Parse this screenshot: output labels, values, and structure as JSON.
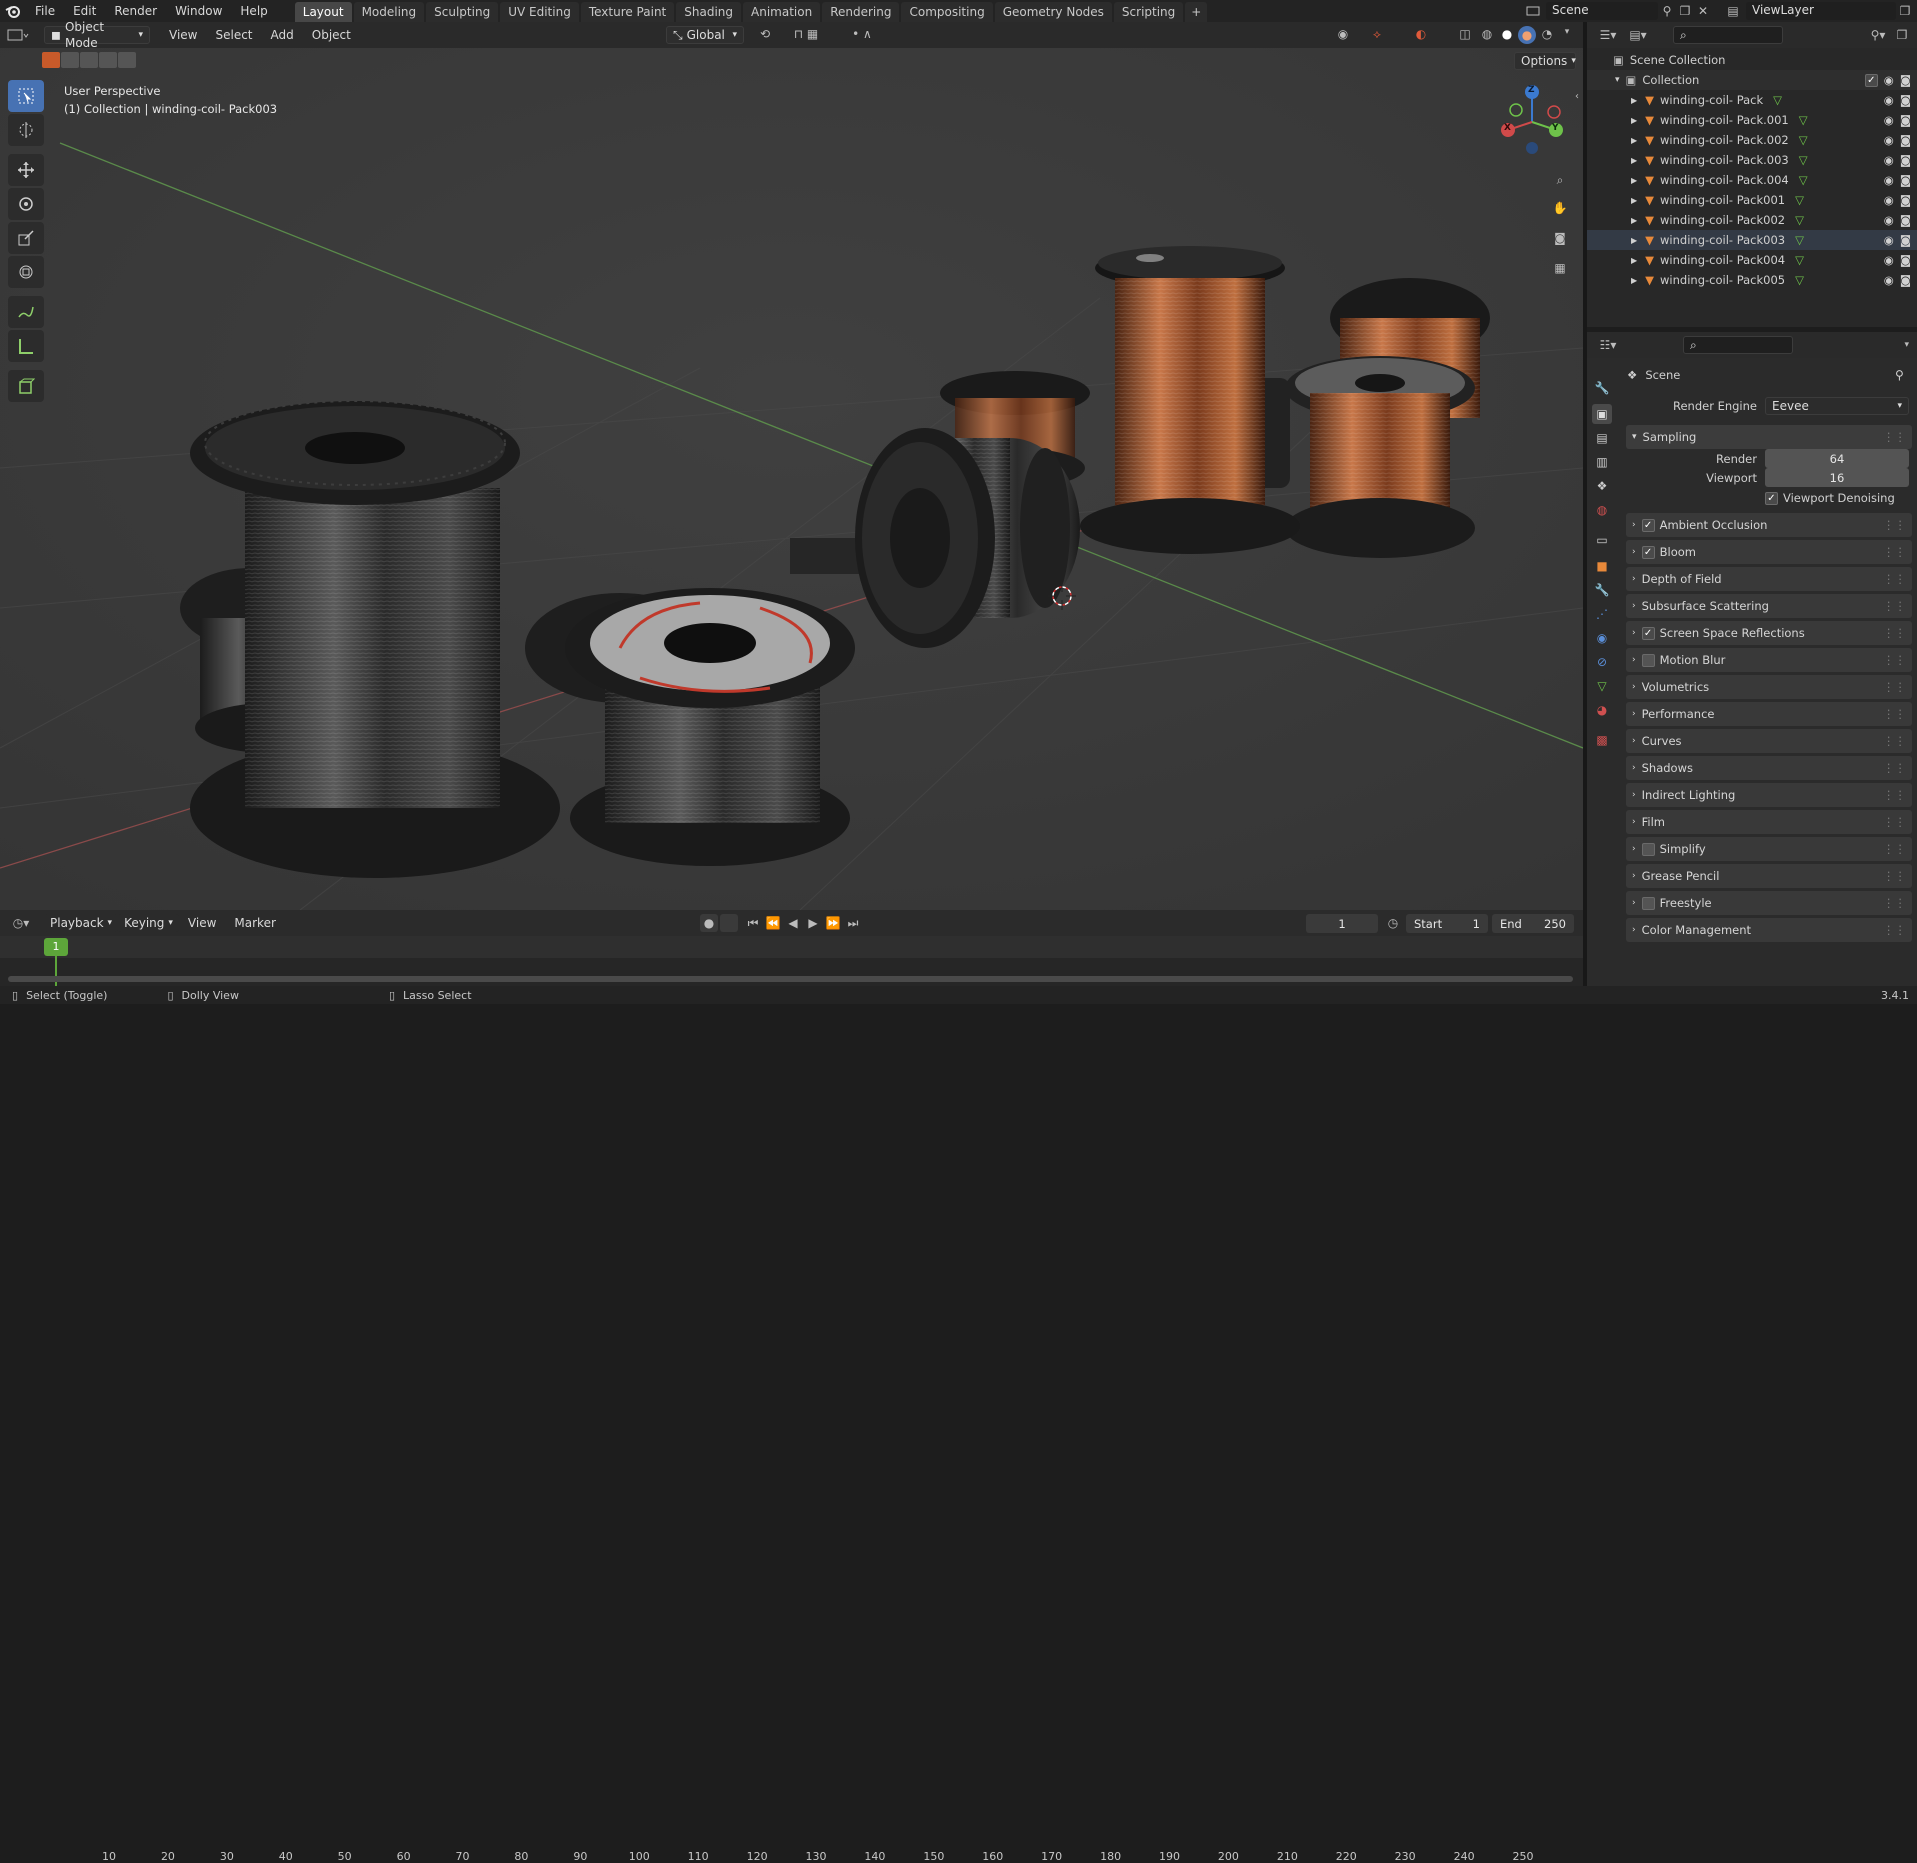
{
  "app": {
    "version": "3.4.1"
  },
  "menu": [
    "File",
    "Edit",
    "Render",
    "Window",
    "Help"
  ],
  "workspaces": [
    {
      "label": "Layout",
      "active": true
    },
    {
      "label": "Modeling"
    },
    {
      "label": "Sculpting"
    },
    {
      "label": "UV Editing"
    },
    {
      "label": "Texture Paint"
    },
    {
      "label": "Shading"
    },
    {
      "label": "Animation"
    },
    {
      "label": "Rendering"
    },
    {
      "label": "Compositing"
    },
    {
      "label": "Geometry Nodes"
    },
    {
      "label": "Scripting"
    }
  ],
  "add_tab_symbol": "+",
  "scene": {
    "name": "Scene"
  },
  "view_layer": {
    "name": "ViewLayer"
  },
  "viewport_header": {
    "mode": "Object Mode",
    "menus": [
      "View",
      "Select",
      "Add",
      "Object"
    ],
    "transform_orientation": "Global",
    "options_label": "Options"
  },
  "viewport": {
    "perspective": "User Perspective",
    "context": "(1) Collection | winding-coil- Pack003",
    "axes": {
      "x": "X",
      "y": "Y",
      "z": "Z"
    }
  },
  "outliner": {
    "scene_collection": "Scene Collection",
    "collection": "Collection",
    "objects": [
      "winding-coil- Pack",
      "winding-coil- Pack.001",
      "winding-coil- Pack.002",
      "winding-coil- Pack.003",
      "winding-coil- Pack.004",
      "winding-coil- Pack001",
      "winding-coil- Pack002",
      "winding-coil- Pack003",
      "winding-coil- Pack004",
      "winding-coil- Pack005"
    ],
    "active_index": 7
  },
  "properties": {
    "context": "Scene",
    "render_engine_label": "Render Engine",
    "render_engine": "Eevee",
    "sampling_label": "Sampling",
    "render_label": "Render",
    "render_samples": "64",
    "viewport_label": "Viewport",
    "viewport_samples": "16",
    "viewport_denoising_label": "Viewport Denoising",
    "panels": [
      {
        "label": "Ambient Occlusion",
        "checkbox": true,
        "checked": true
      },
      {
        "label": "Bloom",
        "checkbox": true,
        "checked": true
      },
      {
        "label": "Depth of Field",
        "checkbox": false
      },
      {
        "label": "Subsurface Scattering",
        "checkbox": false
      },
      {
        "label": "Screen Space Reflections",
        "checkbox": true,
        "checked": true
      },
      {
        "label": "Motion Blur",
        "checkbox": true,
        "checked": false
      },
      {
        "label": "Volumetrics",
        "checkbox": false
      },
      {
        "label": "Performance",
        "checkbox": false
      },
      {
        "label": "Curves",
        "checkbox": false
      },
      {
        "label": "Shadows",
        "checkbox": false
      },
      {
        "label": "Indirect Lighting",
        "checkbox": false
      },
      {
        "label": "Film",
        "checkbox": false
      },
      {
        "label": "Simplify",
        "checkbox": true,
        "checked": false
      },
      {
        "label": "Grease Pencil",
        "checkbox": false
      },
      {
        "label": "Freestyle",
        "checkbox": true,
        "checked": false
      },
      {
        "label": "Color Management",
        "checkbox": false
      }
    ]
  },
  "timeline": {
    "menus": [
      "Playback",
      "Keying",
      "View",
      "Marker"
    ],
    "current_frame": "1",
    "start_label": "Start",
    "start": "1",
    "end_label": "End",
    "end": "250",
    "ruler": [
      "1",
      "10",
      "20",
      "30",
      "40",
      "50",
      "60",
      "70",
      "80",
      "90",
      "100",
      "110",
      "120",
      "130",
      "140",
      "150",
      "160",
      "170",
      "180",
      "190",
      "200",
      "210",
      "220",
      "230",
      "240",
      "250"
    ]
  },
  "status": {
    "items": [
      "Select (Toggle)",
      "Dolly View",
      "Lasso Select"
    ]
  },
  "colors": {
    "accent": "#4772b3",
    "orange": "#e8893a",
    "copper": "#b8683a",
    "green_playhead": "#5da63a"
  }
}
